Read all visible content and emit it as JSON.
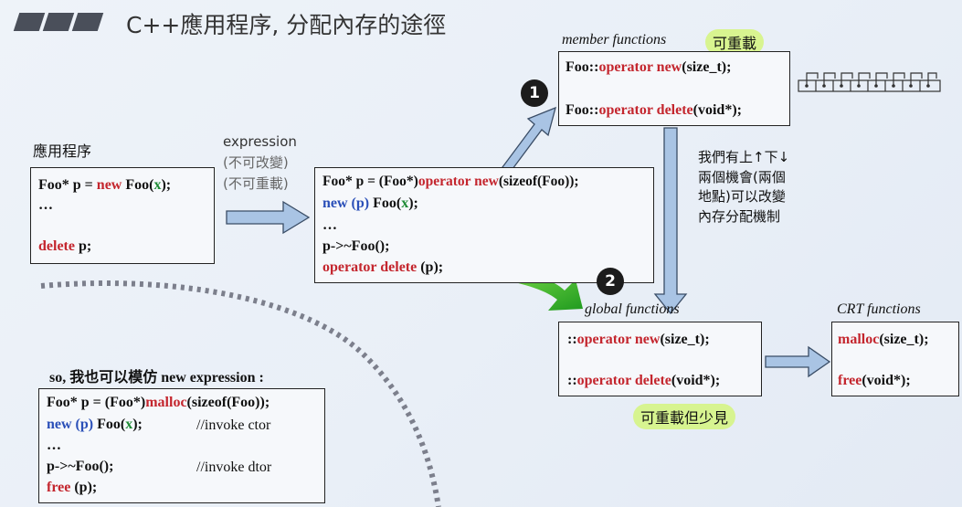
{
  "title": "C++應用程序, 分配內存的途徑",
  "left": {
    "label": "應用程序",
    "code": {
      "l1a": "Foo* p = ",
      "l1b": "new",
      "l1c": " Foo(",
      "l1d": "x",
      "l1e": ");",
      "l2": "…",
      "l3a": "delete",
      "l3b": " p;"
    }
  },
  "expression": {
    "l1": "expression",
    "l2": "(不可改變)",
    "l3": "(不可重載)"
  },
  "middle": {
    "l1a": "Foo* p = (Foo*)",
    "l1b": "operator new",
    "l1c": "(sizeof(Foo));",
    "l2a": "new (p)",
    "l2b": " Foo(",
    "l2c": "x",
    "l2d": ");",
    "l3": "…",
    "l4": "p->~Foo();",
    "l5a": "operator delete",
    "l5b": " (p);"
  },
  "member": {
    "heading": "member functions",
    "highlight": "可重載",
    "l1a": "Foo::",
    "l1b": "operator new",
    "l1c": "(size_t);",
    "l2a": "Foo::",
    "l2b": "operator delete",
    "l2c": "(void*);"
  },
  "note": {
    "l1": "我們有上↑下↓",
    "l2": "兩個機會(兩個",
    "l3": "地點)可以改變",
    "l4": "內存分配機制"
  },
  "badges": {
    "one": "1",
    "two": "2"
  },
  "global": {
    "heading": "global functions",
    "l1a": "::",
    "l1b": "operator new",
    "l1c": "(size_t);",
    "l2a": "::",
    "l2b": "operator delete",
    "l2c": "(void*);",
    "highlight": "可重載但少見"
  },
  "crt": {
    "heading": "CRT functions",
    "l1a": "malloc",
    "l1b": "(size_t);",
    "l2a": "free",
    "l2b": "(void*);"
  },
  "mimic": {
    "heading": "so, 我也可以模仿 new expression :",
    "l1a": "Foo* p = (Foo*)",
    "l1b": "malloc",
    "l1c": "(sizeof(Foo));",
    "l2a": "new (p)",
    "l2b": " Foo(",
    "l2c": "x",
    "l2d": ");",
    "l2e": "//invoke ctor",
    "l3": "…",
    "l4a": "p->~Foo();",
    "l4b": "//invoke dtor",
    "l5a": "free",
    "l5b": " (p);"
  },
  "colors": {
    "keyword": "#c4262e",
    "placement": "#2a4fb8",
    "arg": "#1d8a34",
    "arrow_fill": "#a9c4e4",
    "big_arrow": "#3fbf2a"
  }
}
